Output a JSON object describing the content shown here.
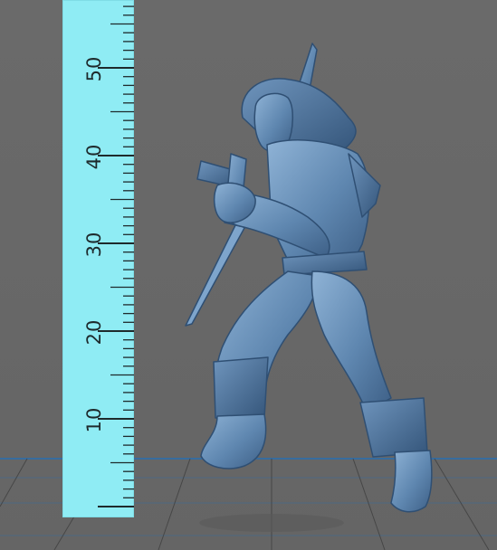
{
  "scene": {
    "background_color": "#6b6b6b",
    "ruler_color": "#8fecf4",
    "model_color": "#5f87b0",
    "grid_color": "#2f6ea8"
  },
  "ruler": {
    "unit_labels": [
      "10",
      "20",
      "30",
      "40",
      "50"
    ]
  },
  "model": {
    "icon": "miniature-warrior-figure"
  }
}
